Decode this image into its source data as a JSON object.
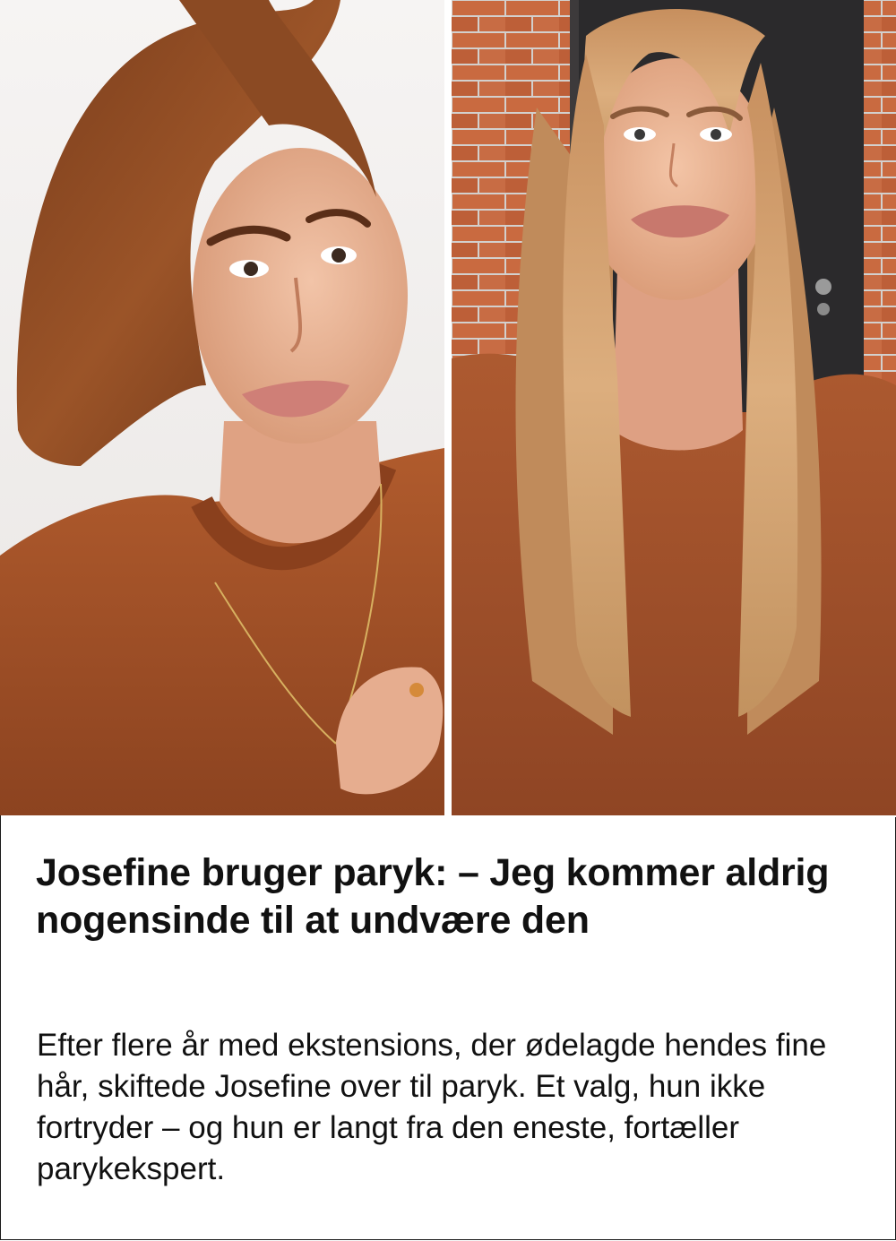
{
  "article": {
    "headline": "Josefine bruger paryk: – Jeg kommer aldrig nogensinde til at undvære den",
    "teaser": "Efter flere år med ekstensions, der ødelagde hendes fine hår, skiftede Josefine over til paryk. Et valg, hun ikke fortryder – og hun er langt fra den eneste, fortæller parykekspert."
  },
  "photos": {
    "left": {
      "subject": "woman-short-auburn-hair-orange-sweater"
    },
    "right": {
      "subject": "woman-long-blonde-wig-orange-sweater-brick-wall"
    }
  },
  "colors": {
    "sweater": "#a8552a",
    "hair_left": "#8a4a22",
    "hair_right": "#d2a070",
    "brick": "#c4683f",
    "door": "#2b2a2c",
    "skin": "#e9b497",
    "text": "#111111",
    "border": "#1a1a1a"
  }
}
